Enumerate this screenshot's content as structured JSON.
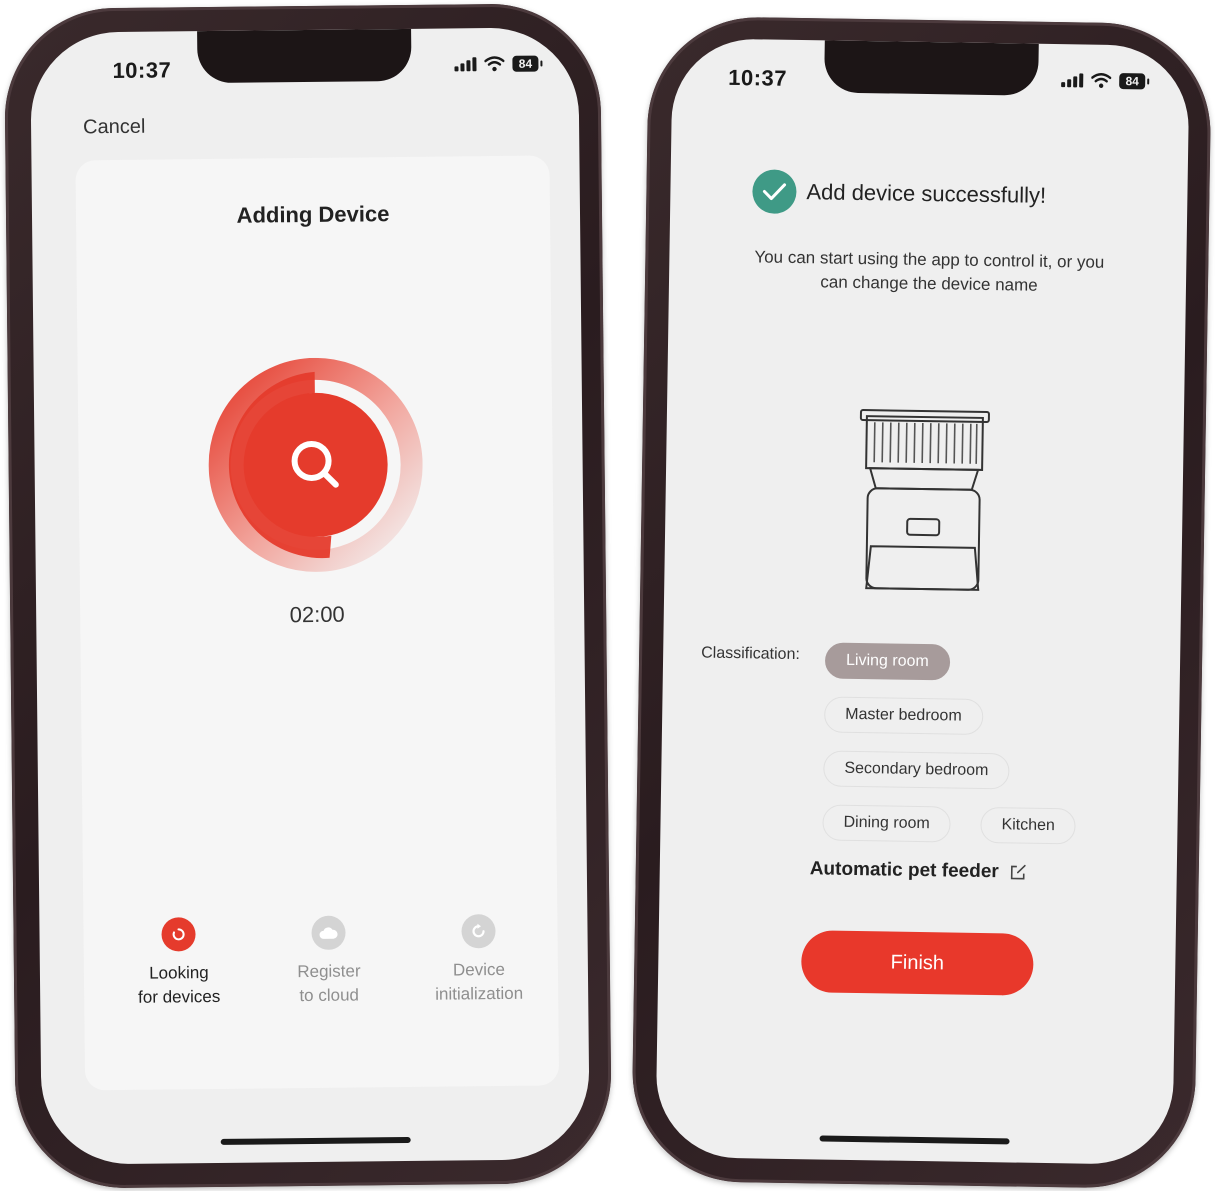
{
  "left_screen": {
    "status": {
      "time": "10:37",
      "battery": "84"
    },
    "cancel_label": "Cancel",
    "title": "Adding Device",
    "timer": "02:00",
    "steps": [
      {
        "label": "Looking\nfor devices",
        "state": "active"
      },
      {
        "label": "Register\nto cloud",
        "state": "inactive"
      },
      {
        "label": "Device\ninitialization",
        "state": "inactive"
      }
    ]
  },
  "right_screen": {
    "status": {
      "time": "10:37",
      "battery": "84"
    },
    "success_title": "Add device successfully!",
    "info_text": "You can start using the app to control it, or you can change the device name",
    "classification_label": "Classification:",
    "rooms": [
      "Living room",
      "Master bedroom",
      "Secondary bedroom",
      "Dining room",
      "Kitchen"
    ],
    "selected_room": "Living room",
    "device_name": "Automatic pet feeder",
    "finish_label": "Finish"
  },
  "colors": {
    "accent_red": "#e53b2c",
    "success_green": "#3f9a86",
    "selected_chip": "#a79b9b",
    "inactive_gray": "#d4d4d4"
  },
  "icons": [
    "search-icon",
    "loading-icon",
    "cloud-icon",
    "refresh-icon",
    "checkmark-icon",
    "edit-icon",
    "pet-feeder-illustration",
    "wifi-icon",
    "signal-icon",
    "battery-icon"
  ]
}
